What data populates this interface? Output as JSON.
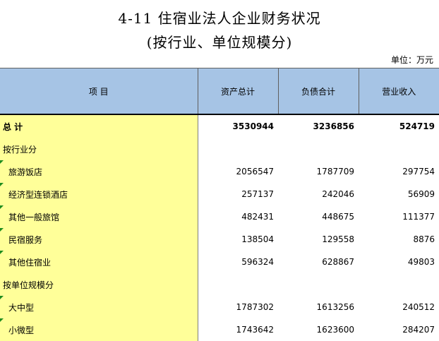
{
  "title": "4-11  住宿业法人企业财务状况",
  "subtitle": "(按行业、单位规模分)",
  "unit": "单位：万元",
  "headers": {
    "item": "项    目",
    "assets": "资产总计",
    "liabilities": "负债合计",
    "revenue": "营业收入"
  },
  "rows": [
    {
      "label": "总    计",
      "assets": "3530944",
      "liabilities": "3236856",
      "revenue": "524719"
    },
    {
      "label": "按行业分",
      "assets": "",
      "liabilities": "",
      "revenue": ""
    },
    {
      "label": "旅游饭店",
      "assets": "2056547",
      "liabilities": "1787709",
      "revenue": "297754"
    },
    {
      "label": "经济型连锁酒店",
      "assets": "257137",
      "liabilities": "242046",
      "revenue": "56909"
    },
    {
      "label": "其他一般旅馆",
      "assets": "482431",
      "liabilities": "448675",
      "revenue": "111377"
    },
    {
      "label": "民宿服务",
      "assets": "138504",
      "liabilities": "129558",
      "revenue": "8876"
    },
    {
      "label": "其他住宿业",
      "assets": "596324",
      "liabilities": "628867",
      "revenue": "49803"
    },
    {
      "label": "按单位规模分",
      "assets": "",
      "liabilities": "",
      "revenue": ""
    },
    {
      "label": "大中型",
      "assets": "1787302",
      "liabilities": "1613256",
      "revenue": "240512"
    },
    {
      "label": "小微型",
      "assets": "1743642",
      "liabilities": "1623600",
      "revenue": "284207"
    }
  ]
}
